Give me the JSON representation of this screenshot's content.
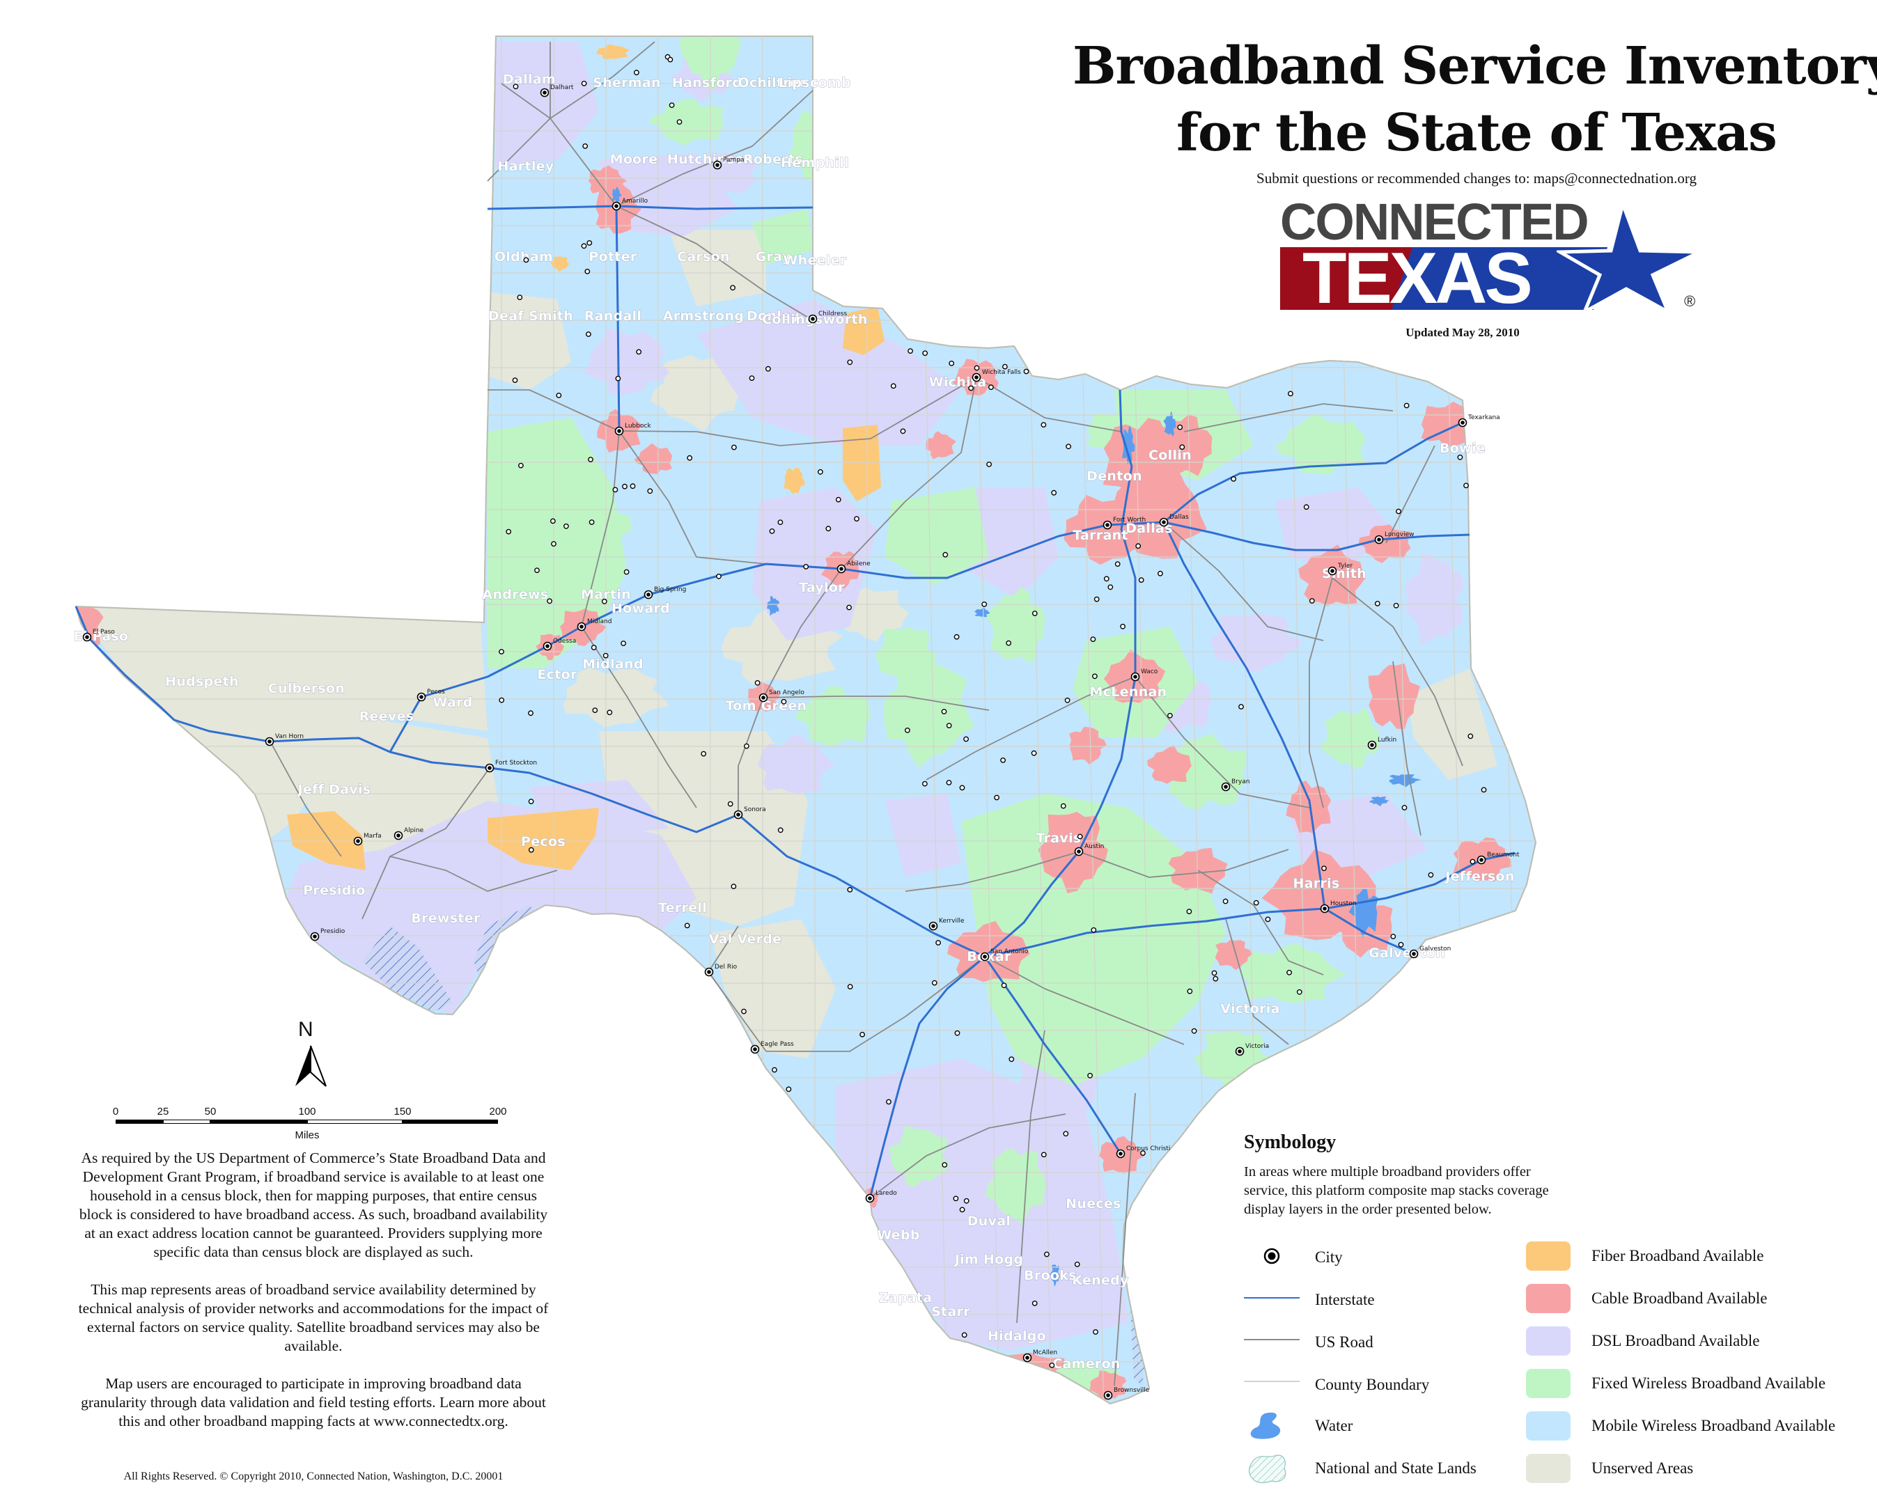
{
  "header": {
    "title_line1": "Broadband Service Inventory",
    "title_line2": "for the State of Texas",
    "submit_note": "Submit questions or recommended changes to: maps@connectednation.org",
    "logo_top": "CONNECTED",
    "logo_bottom": "TEXAS",
    "logo_registered": "®",
    "updated": "Updated May 28, 2010"
  },
  "compass": {
    "north_label": "N"
  },
  "scale_bar": {
    "ticks": [
      "0",
      "25",
      "50",
      "100",
      "150",
      "200"
    ],
    "units": "Miles"
  },
  "disclaimer": {
    "paragraphs": [
      "As required by the US Department of Commerce’s State Broadband Data and Development Grant Program, if broadband service is available to at least one household in a census block, then for mapping purposes, that entire census block is considered to have broadband access. As such, broadband availability at an exact address location cannot be guaranteed.  Providers supplying more specific data than census block are displayed as such.",
      "This map represents areas of broadband service availability determined by technical analysis of provider networks and accommodations for the impact of external factors on service quality.  Satellite broadband services may also be available.",
      "Map users are encouraged to participate in improving broadband data granularity through data validation and field testing efforts. Learn more about this and other broadband mapping facts at www.connectedtx.org."
    ],
    "copyright": "All Rights Reserved. © Copyright 2010, Connected Nation, Washington, D.C. 20001"
  },
  "legend": {
    "title": "Symbology",
    "description": "In areas where multiple broadband providers offer service, this platform composite map stacks coverage display layers in the order presented below.",
    "symbols": [
      {
        "label": "City",
        "icon": "city-dot-icon"
      },
      {
        "label": "Interstate",
        "icon": "interstate-line-icon",
        "color": "#2f6fd0"
      },
      {
        "label": "US Road",
        "icon": "us-road-line-icon",
        "color": "#8a8a8a"
      },
      {
        "label": "County Boundary",
        "icon": "county-boundary-line-icon",
        "color": "#d4d4cc"
      },
      {
        "label": "Water",
        "icon": "water-icon",
        "color": "#5b9ef0"
      },
      {
        "label": "National and State Lands",
        "icon": "hatched-lands-icon",
        "color": "#7ab8b0"
      }
    ],
    "coverage": [
      {
        "label": "Fiber Broadband Available",
        "color": "#fcc97a"
      },
      {
        "label": "Cable Broadband Available",
        "color": "#f7a3a5"
      },
      {
        "label": "DSL Broadband Available",
        "color": "#d9d8fb"
      },
      {
        "label": "Fixed Wireless Broadband Available",
        "color": "#bff5c4"
      },
      {
        "label": "Mobile Wireless Broadband Available",
        "color": "#c2e6fd"
      },
      {
        "label": "Unserved Areas",
        "color": "#e5e7db"
      }
    ]
  },
  "brand_colors": {
    "logo_gray": "#454545",
    "logo_red": "#9b0d1a",
    "logo_blue": "#1b3fa6"
  },
  "map": {
    "counties": [
      "Dallam",
      "Sherman",
      "Hansford",
      "Ochiltree",
      "Lipscomb",
      "Hartley",
      "Moore",
      "Hutchinson",
      "Roberts",
      "Hemphill",
      "Oldham",
      "Potter",
      "Carson",
      "Gray",
      "Wheeler",
      "Deaf Smith",
      "Randall",
      "Armstrong",
      "Donley",
      "Collingsworth",
      "El Paso",
      "Hudspeth",
      "Culberson",
      "Jeff Davis",
      "Presidio",
      "Brewster",
      "Pecos",
      "Terrell",
      "Val Verde",
      "Reeves",
      "Ward",
      "Andrews",
      "Martin",
      "Howard",
      "Midland",
      "Ector",
      "Taylor",
      "Tom Green",
      "Webb",
      "Zapata",
      "Starr",
      "Hidalgo",
      "Cameron",
      "Kenedy",
      "Brooks",
      "Jim Hogg",
      "Duval",
      "Nueces",
      "Bexar",
      "Travis",
      "Harris",
      "Galveston",
      "Dallas",
      "Tarrant",
      "Denton",
      "Collin",
      "McLennan",
      "Smith",
      "Jefferson",
      "Victoria",
      "Wichita",
      "Bowie"
    ],
    "cities": [
      "Amarillo",
      "Lubbock",
      "El Paso",
      "Midland",
      "Odessa",
      "Abilene",
      "San Angelo",
      "Fort Stockton",
      "Wichita Falls",
      "Dallas",
      "Fort Worth",
      "Waco",
      "Austin",
      "San Antonio",
      "Houston",
      "Beaumont",
      "Corpus Christi",
      "Laredo",
      "Brownsville",
      "Tyler",
      "Texarkana",
      "Del Rio",
      "Van Horn",
      "Pecos",
      "Big Spring",
      "Victoria",
      "Galveston",
      "Dalhart",
      "Pampa",
      "Childress",
      "Alpine",
      "Marfa",
      "Presidio",
      "Eagle Pass",
      "Lufkin",
      "Longview",
      "McAllen",
      "Kerrville",
      "Sonora",
      "Bryan"
    ]
  }
}
